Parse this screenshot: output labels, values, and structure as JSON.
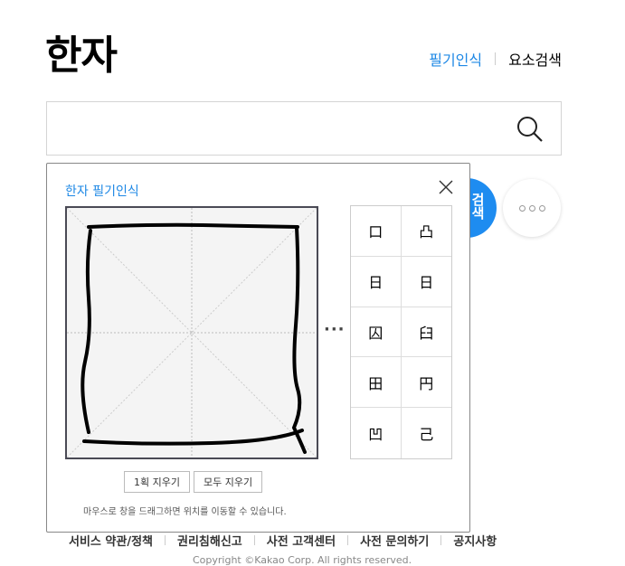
{
  "header": {
    "title": "한자",
    "links": [
      "필기인식",
      "요소검색"
    ]
  },
  "search": {
    "value": "",
    "icon": "search-icon"
  },
  "background": {
    "blue_button_label": "검색"
  },
  "popup": {
    "title": "한자 필기인식",
    "more_indicator": "···",
    "candidates": [
      "口",
      "凸",
      "日",
      "日",
      "囚",
      "臼",
      "田",
      "円",
      "凹",
      "己"
    ],
    "buttons": {
      "undo_stroke": "1획 지우기",
      "clear_all": "모두 지우기"
    },
    "hint": "마우스로 창을 드래그하면 위치를 이동할 수 있습니다."
  },
  "footer": {
    "links": [
      "서비스 약관/정책",
      "권리침해신고",
      "사전 고객센터",
      "사전 문의하기",
      "공지사항"
    ],
    "copyright": "Copyright ©Kakao Corp. All rights reserved."
  },
  "colors": {
    "accent": "#1e88e5",
    "button_blue": "#1e8cf0"
  }
}
